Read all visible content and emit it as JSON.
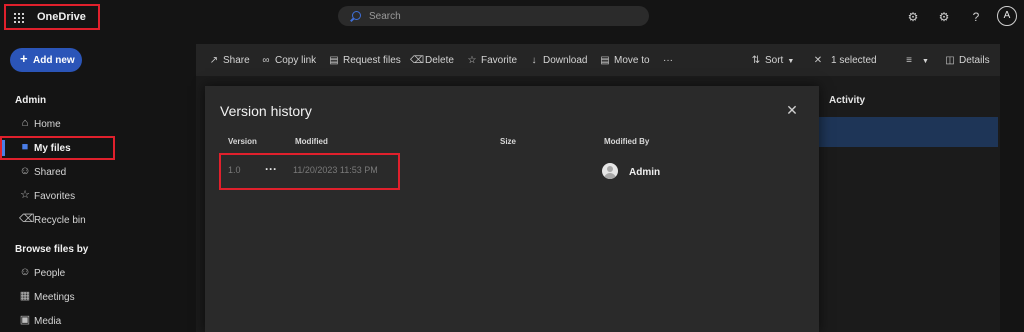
{
  "app": {
    "title": "OneDrive"
  },
  "search": {
    "placeholder": "Search"
  },
  "topbar_icons": [
    "settings-sync-icon",
    "gear-icon",
    "help-icon"
  ],
  "user_initial": "A",
  "sidebar": {
    "add_new_label": "Add new",
    "section_admin": "Admin",
    "items": [
      {
        "label": "Home",
        "icon": "home-icon"
      },
      {
        "label": "My files",
        "icon": "folder-icon"
      },
      {
        "label": "Shared",
        "icon": "shared-people-icon"
      },
      {
        "label": "Favorites",
        "icon": "star-icon"
      },
      {
        "label": "Recycle bin",
        "icon": "recycle-bin-icon"
      }
    ],
    "section_browse": "Browse files by",
    "browse_items": [
      {
        "label": "People",
        "icon": "person-icon"
      },
      {
        "label": "Meetings",
        "icon": "calendar-icon"
      },
      {
        "label": "Media",
        "icon": "image-icon"
      }
    ]
  },
  "command_bar": {
    "share": "Share",
    "copy_link": "Copy link",
    "request_files": "Request files",
    "delete": "Delete",
    "favorite": "Favorite",
    "download": "Download",
    "move_to": "Move to",
    "more": "···",
    "sort": "Sort",
    "selection": "1 selected",
    "details": "Details"
  },
  "file_list": {
    "activity_header": "Activity"
  },
  "version_history": {
    "title": "Version history",
    "columns": {
      "version": "Version",
      "modified": "Modified",
      "size": "Size",
      "modified_by": "Modified By"
    },
    "rows": [
      {
        "version": "1.0",
        "more": "···",
        "modified": "11/20/2023 11:53 PM",
        "size": "",
        "modified_by": "Admin"
      }
    ]
  },
  "colors": {
    "accent": "#2b55b8",
    "highlight_box": "#e0202c",
    "selected_row": "#1e3557"
  }
}
